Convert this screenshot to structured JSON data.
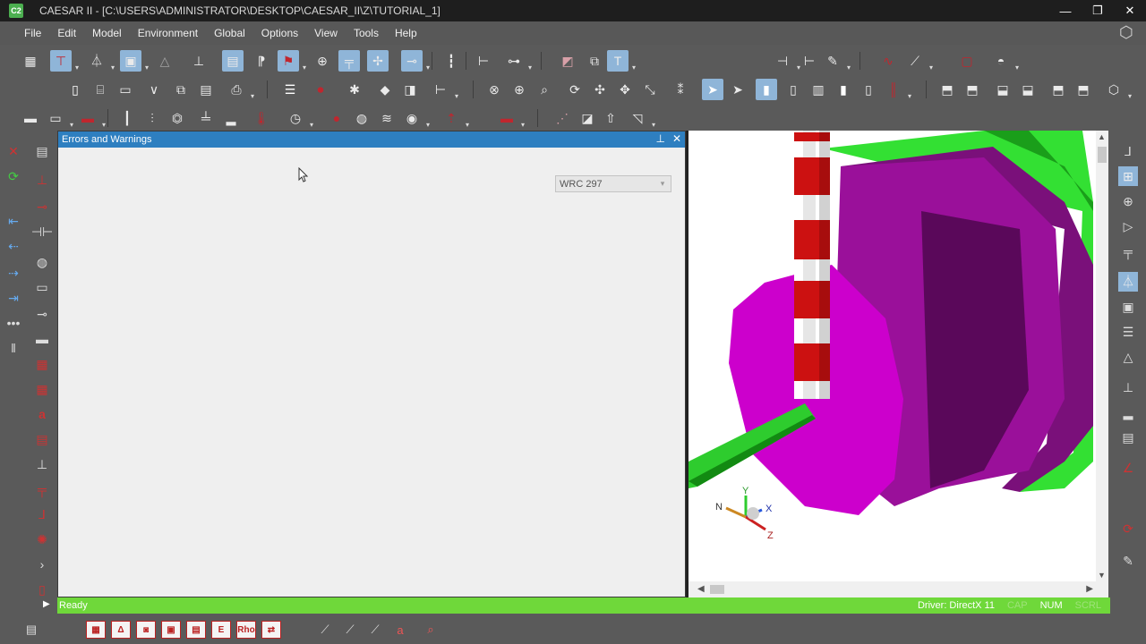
{
  "window": {
    "title": "CAESAR II - [C:\\USERS\\ADMINISTRATOR\\DESKTOP\\CAESAR_II\\Z\\TUTORIAL_1]",
    "app_icon_label": "C2",
    "minimize": "—",
    "restore": "❐",
    "close": "✕"
  },
  "menu": [
    "File",
    "Edit",
    "Model",
    "Environment",
    "Global",
    "Options",
    "View",
    "Tools",
    "Help"
  ],
  "panel": {
    "title": "Errors and Warnings",
    "pin": "📌",
    "close": "✕",
    "combo_value": "WRC 297"
  },
  "status": {
    "left": "Ready",
    "driver": "Driver: DirectX 11",
    "cap": "CAP",
    "num": "NUM",
    "scrl": "SCRL"
  },
  "triad": {
    "x": "X",
    "y": "Y",
    "z": "Z",
    "n": "N"
  },
  "colors": {
    "status_green": "#6fd83a",
    "panel_header": "#2e7fc0",
    "pipe_green": "#2ecc2e",
    "vessel_magenta": "#cc00cc",
    "support_red": "#cc1111"
  },
  "bottom_labels": [
    "Δ",
    "E",
    "Rho"
  ]
}
